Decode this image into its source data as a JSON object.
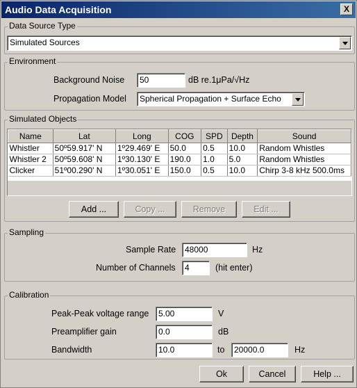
{
  "window": {
    "title": "Audio Data Acquisition",
    "close_label": "X"
  },
  "data_source": {
    "legend": "Data Source Type",
    "selected": "Simulated Sources"
  },
  "environment": {
    "legend": "Environment",
    "noise_label": "Background Noise",
    "noise_value": "50",
    "noise_unit": "dB re.1μPa/√Hz",
    "propagation_label": "Propagation Model",
    "propagation_value": "Spherical Propagation + Surface Echo"
  },
  "objects": {
    "legend": "Simulated Objects",
    "columns": [
      "Name",
      "Lat",
      "Long",
      "COG",
      "SPD",
      "Depth",
      "Sound"
    ],
    "rows": [
      [
        "Whistler",
        "50º59.917' N",
        "1º29.469' E",
        "50.0",
        "0.5",
        "10.0",
        "Random Whistles"
      ],
      [
        "Whistler 2",
        "50º59.608' N",
        "1º30.130' E",
        "190.0",
        "1.0",
        "5.0",
        "Random Whistles"
      ],
      [
        "Clicker",
        "51º00.290' N",
        "1º30.051' E",
        "150.0",
        "0.5",
        "10.0",
        "Chirp 3-8 kHz 500.0ms"
      ]
    ],
    "add_label": "Add ...",
    "copy_label": "Copy ...",
    "remove_label": "Remove",
    "edit_label": "Edit ..."
  },
  "sampling": {
    "legend": "Sampling",
    "rate_label": "Sample Rate",
    "rate_value": "48000",
    "rate_unit": "Hz",
    "channels_label": "Number of Channels",
    "channels_value": "4",
    "channels_hint": "(hit enter)"
  },
  "calibration": {
    "legend": "Calibration",
    "vpp_label": "Peak-Peak voltage range",
    "vpp_value": "5.00",
    "vpp_unit": "V",
    "gain_label": "Preamplifier gain",
    "gain_value": "0.0",
    "gain_unit": "dB",
    "bw_label": "Bandwidth",
    "bw_low": "10.0",
    "bw_to": "to",
    "bw_high": "20000.0",
    "bw_unit": "Hz"
  },
  "footer": {
    "ok_label": "Ok",
    "cancel_label": "Cancel",
    "help_label": "Help ..."
  }
}
